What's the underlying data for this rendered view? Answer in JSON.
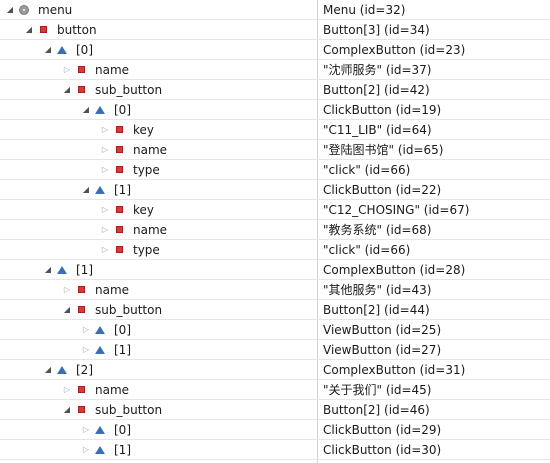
{
  "rows": [
    {
      "depth": 0,
      "arrow": "expanded",
      "icon": "root-icon",
      "name": "menu",
      "value": "Menu  (id=32)"
    },
    {
      "depth": 1,
      "arrow": "expanded",
      "icon": "field-icon",
      "name": "button",
      "value": "Button[3]  (id=34)"
    },
    {
      "depth": 2,
      "arrow": "expanded",
      "icon": "element-icon",
      "name": "[0]",
      "value": "ComplexButton  (id=23)"
    },
    {
      "depth": 3,
      "arrow": "collapsed",
      "icon": "field-icon",
      "name": "name",
      "value": "\"沈师服务\" (id=37)"
    },
    {
      "depth": 3,
      "arrow": "expanded",
      "icon": "field-icon",
      "name": "sub_button",
      "value": "Button[2]  (id=42)"
    },
    {
      "depth": 4,
      "arrow": "expanded",
      "icon": "element-icon",
      "name": "[0]",
      "value": "ClickButton  (id=19)"
    },
    {
      "depth": 5,
      "arrow": "collapsed",
      "icon": "field-icon",
      "name": "key",
      "value": "\"C11_LIB\" (id=64)"
    },
    {
      "depth": 5,
      "arrow": "collapsed",
      "icon": "field-icon",
      "name": "name",
      "value": "\"登陆图书馆\" (id=65)"
    },
    {
      "depth": 5,
      "arrow": "collapsed",
      "icon": "field-icon",
      "name": "type",
      "value": "\"click\" (id=66)"
    },
    {
      "depth": 4,
      "arrow": "expanded",
      "icon": "element-icon",
      "name": "[1]",
      "value": "ClickButton  (id=22)"
    },
    {
      "depth": 5,
      "arrow": "collapsed",
      "icon": "field-icon",
      "name": "key",
      "value": "\"C12_CHOSING\" (id=67)"
    },
    {
      "depth": 5,
      "arrow": "collapsed",
      "icon": "field-icon",
      "name": "name",
      "value": "\"教务系统\" (id=68)"
    },
    {
      "depth": 5,
      "arrow": "collapsed",
      "icon": "field-icon",
      "name": "type",
      "value": "\"click\" (id=66)"
    },
    {
      "depth": 2,
      "arrow": "expanded",
      "icon": "element-icon",
      "name": "[1]",
      "value": "ComplexButton  (id=28)"
    },
    {
      "depth": 3,
      "arrow": "collapsed",
      "icon": "field-icon",
      "name": "name",
      "value": "\"其他服务\" (id=43)"
    },
    {
      "depth": 3,
      "arrow": "expanded",
      "icon": "field-icon",
      "name": "sub_button",
      "value": "Button[2]  (id=44)"
    },
    {
      "depth": 4,
      "arrow": "collapsed",
      "icon": "element-icon",
      "name": "[0]",
      "value": "ViewButton  (id=25)"
    },
    {
      "depth": 4,
      "arrow": "collapsed",
      "icon": "element-icon",
      "name": "[1]",
      "value": "ViewButton  (id=27)"
    },
    {
      "depth": 2,
      "arrow": "expanded",
      "icon": "element-icon",
      "name": "[2]",
      "value": "ComplexButton  (id=31)"
    },
    {
      "depth": 3,
      "arrow": "collapsed",
      "icon": "field-icon",
      "name": "name",
      "value": "\"关于我们\" (id=45)"
    },
    {
      "depth": 3,
      "arrow": "expanded",
      "icon": "field-icon",
      "name": "sub_button",
      "value": "Button[2]  (id=46)"
    },
    {
      "depth": 4,
      "arrow": "collapsed",
      "icon": "element-icon",
      "name": "[0]",
      "value": "ClickButton  (id=29)"
    },
    {
      "depth": 4,
      "arrow": "collapsed",
      "icon": "element-icon",
      "name": "[1]",
      "value": "ClickButton  (id=30)"
    }
  ],
  "colors": {
    "field_icon": "#d63a3a",
    "element_icon": "#3a6fb8",
    "root_icon": "#9a9a9a"
  }
}
